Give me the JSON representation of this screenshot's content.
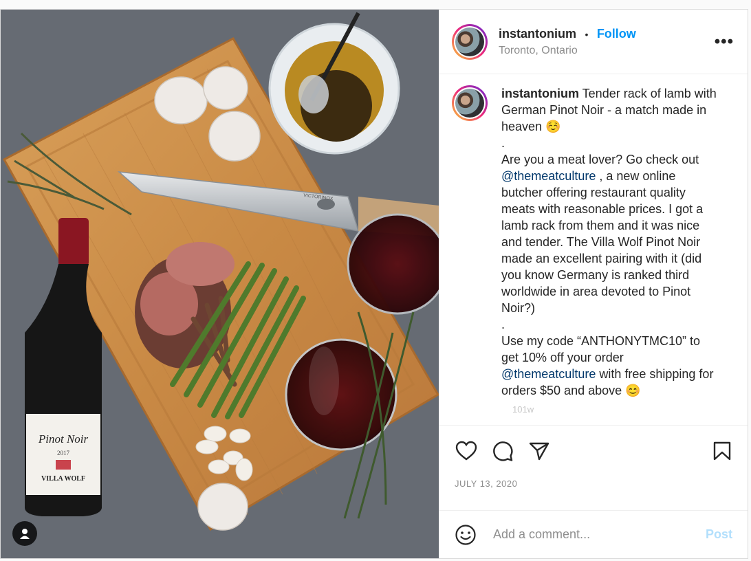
{
  "header": {
    "username": "instantonium",
    "separator": "•",
    "follow_label": "Follow",
    "location": "Toronto, Ontario",
    "more_label": "•••"
  },
  "caption": {
    "username": "instantonium",
    "line1": " Tender rack of lamb with German Pinot Noir - a match made in heaven ☺️",
    "dot1": ".",
    "para1_a": "Are you a meat lover? Go check out ",
    "mention1": "@themeatculture",
    "para1_b": " , a new online butcher offering restaurant quality meats with reasonable prices. I got a lamb rack from them and it was nice and tender. The Villa Wolf Pinot Noir made an excellent pairing with it (did you know Germany is ranked third worldwide in area devoted to Pinot Noir?)",
    "dot2": ".",
    "para2_a": "Use my code “ANTHONYTMC10” to get 10% off your order ",
    "mention2": "@themeatculture",
    "para2_b": " with free shipping for orders $50 and above 😊",
    "truncated_text": "101w"
  },
  "actions": {
    "like_icon": "heart-icon",
    "comment_icon": "comment-bubble-icon",
    "share_icon": "paper-plane-icon",
    "save_icon": "bookmark-icon"
  },
  "date": "JULY 13, 2020",
  "comment_box": {
    "emoji_icon": "smiley-icon",
    "placeholder": "Add a comment...",
    "post_label": "Post"
  },
  "media": {
    "wine_label": "Pinot Noir",
    "wine_year": "2017",
    "winery": "VILLA WOLF",
    "knife_brand": "VICTORINOX"
  },
  "colors": {
    "follow": "#0095f6",
    "mention": "#00376b",
    "post_disabled": "#b2dffc",
    "muted": "#8e8e8e"
  }
}
